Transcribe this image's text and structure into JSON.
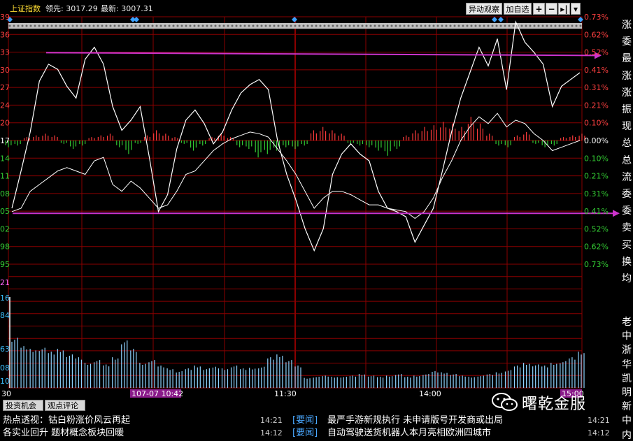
{
  "header": {
    "index_name": "上证指数",
    "lead_label": "领先: 3017.29",
    "last_label": "最新: 3007.31",
    "btn_anomaly": "异动观察",
    "btn_add_watch": "加自选",
    "icon_plus": "plus-icon",
    "icon_minus": "minus-icon",
    "icon_next": "next-icon",
    "icon_dropdown": "chevron-down-icon"
  },
  "left_axis": [
    "39",
    "36",
    "33",
    "30",
    "27",
    "24",
    "20",
    "17",
    "14",
    "11",
    "08",
    "05",
    "02",
    "98",
    "95"
  ],
  "right_axis": [
    "0.73%",
    "0.62%",
    "0.52%",
    "0.41%",
    "0.31%",
    "0.21%",
    "0.10%",
    "0.00%",
    "0.10%",
    "0.21%",
    "0.31%",
    "0.41%",
    "0.52%",
    "0.62%",
    "0.73%"
  ],
  "vol_axis": [
    "21",
    "16",
    "84",
    "63",
    "08",
    "10"
  ],
  "time_labels": [
    "30",
    "107-07 10:42",
    "11:30",
    "14:00",
    "15:00"
  ],
  "right_strip_chars_top": [
    "涨",
    "委",
    "最",
    "涨",
    "涨",
    "振",
    "现",
    "总",
    "总",
    "流",
    "委",
    "委",
    "卖",
    "买",
    "换",
    "均"
  ],
  "right_strip_chars_bottom": [
    "老",
    "中",
    "浙",
    "华",
    "凯",
    "明",
    "新",
    "中",
    "内"
  ],
  "tabs": [
    "投资机会",
    "观点评论"
  ],
  "news": [
    {
      "left": "热点透视：钴白粉涨价风云再起",
      "time1": "14:21",
      "tag": "[要闻]",
      "right": "最严手游新规执行 未申请版号开发商或出局",
      "time2": "14:21"
    },
    {
      "left": "各实业回升 题材概念板块回暖",
      "time1": "14:12",
      "tag": "[要闻]",
      "right": "自动驾驶送货机器人本月亮相欧洲四城市",
      "time2": "14:12"
    }
  ],
  "watermark": "曙乾金服",
  "colors": {
    "grid": "#8a0000",
    "price_line": "#ffffff",
    "avg_line": "#ffffff",
    "up_bar": "#ff3b3b",
    "down_bar": "#33cc33",
    "vol_bar": "#8fd3ff",
    "arrow": "#cc33cc",
    "marker": "#3aa0ff"
  },
  "chart_data": {
    "type": "line",
    "title": "上证指数",
    "x_time_ticks": [
      "10:42",
      "11:30",
      "14:00",
      "15:00"
    ],
    "ylim_pct": [
      -0.73,
      0.73
    ],
    "price_pct": [
      -0.4,
      -0.18,
      0.05,
      0.35,
      0.45,
      0.42,
      0.32,
      0.25,
      0.48,
      0.55,
      0.45,
      0.2,
      0.06,
      0.12,
      0.2,
      -0.1,
      -0.42,
      -0.32,
      -0.05,
      0.12,
      0.18,
      0.1,
      -0.02,
      0.05,
      0.18,
      0.28,
      0.33,
      0.36,
      0.3,
      0.0,
      -0.2,
      -0.35,
      -0.52,
      -0.65,
      -0.52,
      -0.2,
      -0.08,
      -0.02,
      -0.08,
      -0.12,
      -0.3,
      -0.4,
      -0.42,
      -0.45,
      -0.6,
      -0.5,
      -0.4,
      -0.18,
      0.05,
      0.25,
      0.4,
      0.55,
      0.44,
      0.6,
      0.3,
      0.7,
      0.58,
      0.52,
      0.45,
      0.2,
      0.32,
      0.36,
      0.4
    ],
    "avg_pct": [
      -0.42,
      -0.4,
      -0.3,
      -0.26,
      -0.22,
      -0.18,
      -0.16,
      -0.18,
      -0.2,
      -0.12,
      -0.1,
      -0.26,
      -0.3,
      -0.24,
      -0.28,
      -0.34,
      -0.4,
      -0.38,
      -0.3,
      -0.2,
      -0.18,
      -0.12,
      -0.06,
      -0.02,
      0.01,
      0.03,
      0.05,
      0.04,
      0.02,
      -0.05,
      -0.12,
      -0.2,
      -0.3,
      -0.4,
      -0.34,
      -0.3,
      -0.3,
      -0.32,
      -0.35,
      -0.38,
      -0.38,
      -0.4,
      -0.41,
      -0.42,
      -0.46,
      -0.42,
      -0.34,
      -0.22,
      -0.12,
      0.0,
      0.08,
      0.14,
      0.1,
      0.16,
      0.08,
      0.12,
      0.1,
      0.04,
      0.0,
      -0.06,
      -0.04,
      -0.02,
      0.0
    ],
    "diff_bars": [
      -0.04,
      -0.03,
      0.02,
      0.03,
      0.04,
      0.03,
      -0.02,
      -0.05,
      -0.03,
      0.02,
      0.03,
      0.04,
      -0.04,
      -0.08,
      -0.02,
      0.03,
      0.06,
      0.04,
      0.02,
      -0.02,
      -0.06,
      -0.03,
      0.02,
      0.04,
      0.02,
      -0.04,
      -0.05,
      -0.1,
      -0.08,
      -0.06,
      -0.04,
      -0.05,
      -0.03,
      0.06,
      0.08,
      0.06,
      0.04,
      -0.02,
      -0.03,
      -0.04,
      -0.06,
      -0.09,
      -0.05,
      0.03,
      0.06,
      0.08,
      0.09,
      0.11,
      0.1,
      0.08,
      0.14,
      0.1,
      0.04,
      -0.03,
      -0.04,
      0.03,
      0.05,
      -0.02,
      -0.04,
      -0.03,
      0.02,
      0.03,
      0.04
    ],
    "volume": [
      0.9,
      0.75,
      0.7,
      0.72,
      0.65,
      0.7,
      0.6,
      0.55,
      0.45,
      0.5,
      0.42,
      0.55,
      0.85,
      0.7,
      0.45,
      0.5,
      0.4,
      0.35,
      0.3,
      0.35,
      0.4,
      0.35,
      0.38,
      0.35,
      0.4,
      0.35,
      0.36,
      0.38,
      0.55,
      0.6,
      0.5,
      0.4,
      0.18,
      0.2,
      0.22,
      0.2,
      0.2,
      0.22,
      0.25,
      0.22,
      0.2,
      0.22,
      0.25,
      0.2,
      0.22,
      0.25,
      0.3,
      0.28,
      0.25,
      0.22,
      0.2,
      0.22,
      0.25,
      0.28,
      0.32,
      0.4,
      0.45,
      0.42,
      0.4,
      0.45,
      0.48,
      0.55,
      0.65
    ],
    "ref_line_upper_pct": 0.51,
    "ref_line_lower_pct": -0.43
  }
}
